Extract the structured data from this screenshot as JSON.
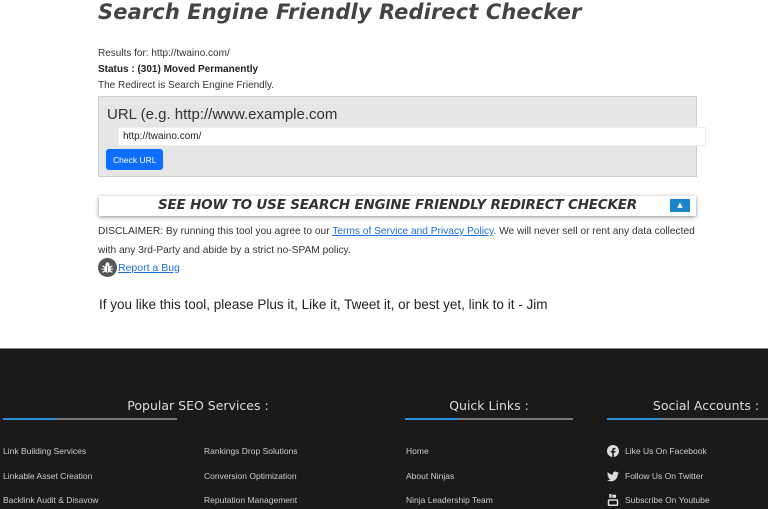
{
  "page": {
    "title": "Search Engine Friendly Redirect Checker"
  },
  "results": {
    "results_for": "Results for: http://twaino.com/",
    "status": "Status : (301) Moved Permanently",
    "message": "The Redirect is Search Engine Friendly."
  },
  "form": {
    "label": "URL (e.g. http://www.example.com",
    "url_value": "http://twaino.com/",
    "check_button": "Check URL"
  },
  "howto": {
    "title": "SEE HOW TO USE SEARCH ENGINE FRIENDLY REDIRECT CHECKER",
    "toggle_icon": "caret-up-icon",
    "toggle_glyph": "▲"
  },
  "disclaimer": {
    "prefix": "DISCLAIMER: By running this tool you agree to our ",
    "link": "Terms of Service and Privacy Policy",
    "suffix": ". We will never sell or rent any data collected with any 3rd-Party and abide by a strict no-SPAM policy."
  },
  "bug": {
    "icon": "bug-icon",
    "link": "Report a Bug"
  },
  "like_text": "If you like this tool, please Plus it, Like it, Tweet it, or best yet, link to it - Jim",
  "footer": {
    "colors": {
      "background": "#1a1a1a",
      "accent": "#2a8fd8"
    },
    "services": {
      "heading": "Popular SEO Services :",
      "left": [
        "Link Building Services",
        "Linkable Asset Creation",
        "Backlink Audit & Disavow"
      ],
      "right": [
        "Rankings Drop Solutions",
        "Conversion Optimization",
        "Reputation Management"
      ]
    },
    "quick_links": {
      "heading": "Quick Links :",
      "items": [
        "Home",
        "About Ninjas",
        "Ninja Leadership Team"
      ]
    },
    "social": {
      "heading": "Social Accounts :",
      "items": [
        {
          "icon": "facebook-icon",
          "label": "Like Us On Facebook"
        },
        {
          "icon": "twitter-icon",
          "label": "Follow Us On Twitter"
        },
        {
          "icon": "youtube-icon",
          "label": "Subscribe On Youtube"
        }
      ]
    }
  }
}
